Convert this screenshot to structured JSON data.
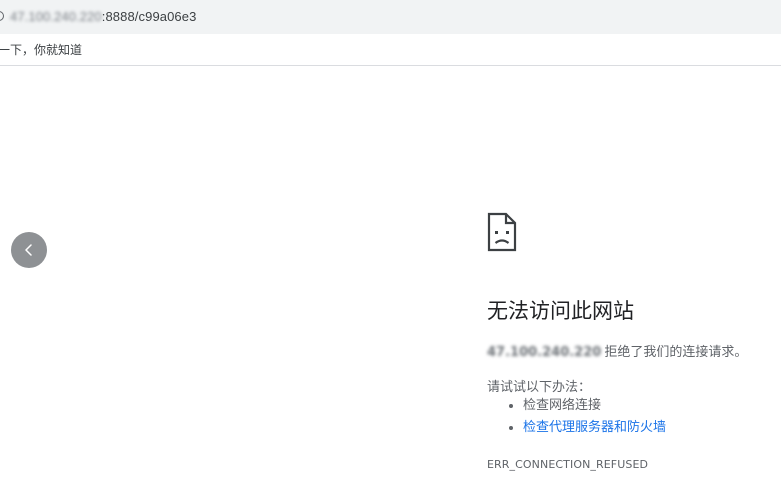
{
  "address_bar": {
    "url_hidden_part": "47.100.240.220",
    "url_visible_part": ":8888/c99a06e3"
  },
  "bookmarks": {
    "items": [
      {
        "label": "一下，你就知道"
      }
    ]
  },
  "error": {
    "title": "无法访问此网站",
    "host": "47.100.240.220",
    "message": "拒绝了我们的连接请求。",
    "suggestions_label": "请试试以下办法：",
    "suggestions": [
      {
        "label": "检查网络连接"
      },
      {
        "label": "检查代理服务器和防火墙"
      }
    ],
    "code": "ERR_CONNECTION_REFUSED"
  },
  "colors": {
    "link": "#1a73e8",
    "text_secondary": "#5f6368",
    "title": "#202124",
    "back_button": "#8e9194",
    "address_bar_bg": "#f1f3f4"
  },
  "icons": {
    "error_icon": "sad-page-icon",
    "back_icon": "chevron-left-icon",
    "address_icon": "info-icon"
  }
}
